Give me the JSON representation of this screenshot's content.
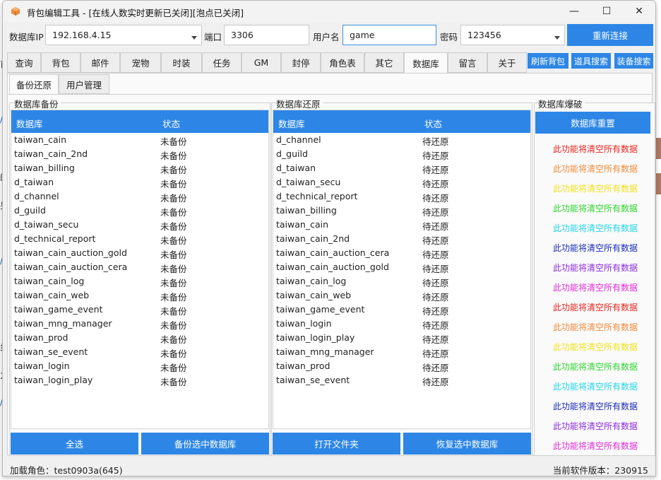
{
  "background": {
    "left_fragments": [
      "首",
      "/",
      "的",
      "另",
      "/",
      "步",
      "力",
      "/"
    ]
  },
  "window": {
    "title": "背包编辑工具 - [在线人数实时更新已关闭][泡点已关闭]",
    "min_glyph": "—",
    "max_glyph": "☐",
    "close_glyph": "✕"
  },
  "connection": {
    "ip_label": "数据库IP",
    "ip_value": "192.168.4.15",
    "port_label": "端口",
    "port_value": "3306",
    "user_label": "用户名",
    "user_value": "game",
    "pass_label": "密码",
    "pass_value": "123456",
    "reconnect_label": "重新连接"
  },
  "tabs": [
    "查询",
    "背包",
    "邮件",
    "宠物",
    "时装",
    "任务",
    "GM",
    "封停",
    "角色表",
    "其它",
    "数据库",
    "留言",
    "关于"
  ],
  "active_tab": "数据库",
  "top_buttons": {
    "refresh_bag": "刷新背包",
    "item_search": "道具搜索",
    "equip_search": "装备搜索"
  },
  "subtabs": [
    "备份还原",
    "用户管理"
  ],
  "backup": {
    "group_title": "数据库备份",
    "col_db": "数据库",
    "col_status": "状态",
    "rows": [
      {
        "db": "taiwan_cain",
        "status": "未备份"
      },
      {
        "db": "taiwan_cain_2nd",
        "status": "未备份"
      },
      {
        "db": "taiwan_billing",
        "status": "未备份"
      },
      {
        "db": "d_taiwan",
        "status": "未备份"
      },
      {
        "db": "d_channel",
        "status": "未备份"
      },
      {
        "db": "d_guild",
        "status": "未备份"
      },
      {
        "db": "d_taiwan_secu",
        "status": "未备份"
      },
      {
        "db": "d_technical_report",
        "status": "未备份"
      },
      {
        "db": "taiwan_cain_auction_gold",
        "status": "未备份"
      },
      {
        "db": "taiwan_cain_auction_cera",
        "status": "未备份"
      },
      {
        "db": "taiwan_cain_log",
        "status": "未备份"
      },
      {
        "db": "taiwan_cain_web",
        "status": "未备份"
      },
      {
        "db": "taiwan_game_event",
        "status": "未备份"
      },
      {
        "db": "taiwan_mng_manager",
        "status": "未备份"
      },
      {
        "db": "taiwan_prod",
        "status": "未备份"
      },
      {
        "db": "taiwan_se_event",
        "status": "未备份"
      },
      {
        "db": "taiwan_login",
        "status": "未备份"
      },
      {
        "db": "taiwan_login_play",
        "status": "未备份"
      }
    ],
    "select_all": "全选",
    "backup_selected": "备份选中数据库"
  },
  "restore": {
    "group_title": "数据库还原",
    "col_db": "数据库",
    "col_status": "状态",
    "rows": [
      {
        "db": "d_channel",
        "status": "待还原"
      },
      {
        "db": "d_guild",
        "status": "待还原"
      },
      {
        "db": "d_taiwan",
        "status": "待还原"
      },
      {
        "db": "d_taiwan_secu",
        "status": "待还原"
      },
      {
        "db": "d_technical_report",
        "status": "待还原"
      },
      {
        "db": "taiwan_billing",
        "status": "待还原"
      },
      {
        "db": "taiwan_cain",
        "status": "待还原"
      },
      {
        "db": "taiwan_cain_2nd",
        "status": "待还原"
      },
      {
        "db": "taiwan_cain_auction_cera",
        "status": "待还原"
      },
      {
        "db": "taiwan_cain_auction_gold",
        "status": "待还原"
      },
      {
        "db": "taiwan_cain_log",
        "status": "待还原"
      },
      {
        "db": "taiwan_cain_web",
        "status": "待还原"
      },
      {
        "db": "taiwan_game_event",
        "status": "待还原"
      },
      {
        "db": "taiwan_login",
        "status": "待还原"
      },
      {
        "db": "taiwan_login_play",
        "status": "待还原"
      },
      {
        "db": "taiwan_mng_manager",
        "status": "待还原"
      },
      {
        "db": "taiwan_prod",
        "status": "待还原"
      },
      {
        "db": "taiwan_se_event",
        "status": "待还原"
      }
    ],
    "open_folder": "打开文件夹",
    "restore_selected": "恢复选中数据库"
  },
  "wipe": {
    "group_title": "数据库爆破",
    "reset_label": "数据库重置",
    "warnings": [
      {
        "text": "此功能将清空所有数据",
        "color": "#e8231c"
      },
      {
        "text": "此功能将清空所有数据",
        "color": "#f08a3a"
      },
      {
        "text": "此功能将清空所有数据",
        "color": "#f0e21c"
      },
      {
        "text": "此功能将清空所有数据",
        "color": "#2ed52e"
      },
      {
        "text": "此功能将清空所有数据",
        "color": "#22d6e8"
      },
      {
        "text": "此功能将清空所有数据",
        "color": "#1a2ab8"
      },
      {
        "text": "此功能将清空所有数据",
        "color": "#8a2ae0"
      },
      {
        "text": "此功能将清空所有数据",
        "color": "#e02ad8"
      },
      {
        "text": "此功能将清空所有数据",
        "color": "#e8231c"
      },
      {
        "text": "此功能将清空所有数据",
        "color": "#f08a3a"
      },
      {
        "text": "此功能将清空所有数据",
        "color": "#f0e21c"
      },
      {
        "text": "此功能将清空所有数据",
        "color": "#2ed52e"
      },
      {
        "text": "此功能将清空所有数据",
        "color": "#22d6e8"
      },
      {
        "text": "此功能将清空所有数据",
        "color": "#1a2ab8"
      },
      {
        "text": "此功能将清空所有数据",
        "color": "#8a2ae0"
      },
      {
        "text": "此功能将清空所有数据",
        "color": "#e02ad8"
      }
    ]
  },
  "status": {
    "left": "加载角色：test0903a(645)",
    "right": "当前软件版本：230915"
  },
  "colors": {
    "accent": "#2d86e6"
  }
}
